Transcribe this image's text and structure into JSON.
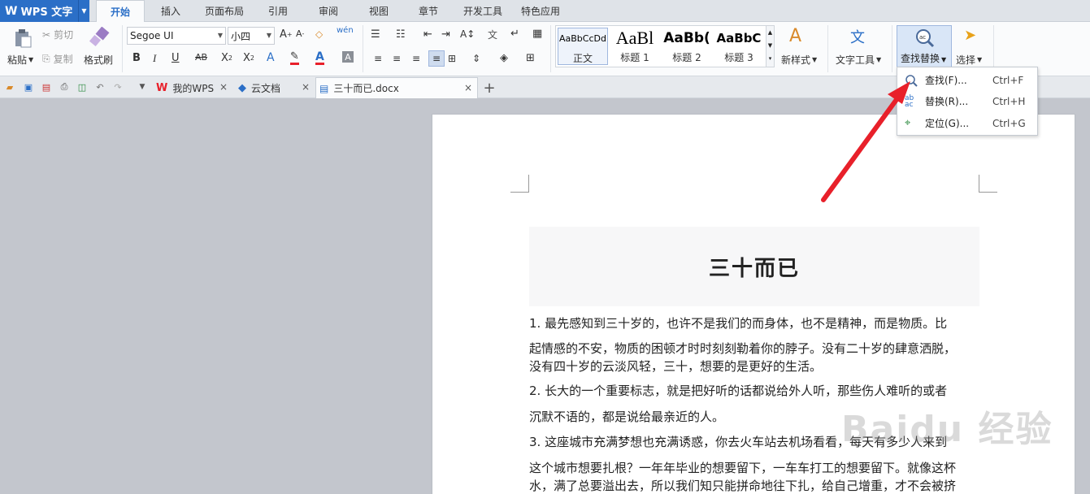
{
  "app": {
    "logo": "W",
    "name": "WPS 文字"
  },
  "menu_tabs": [
    "开始",
    "插入",
    "页面布局",
    "引用",
    "审阅",
    "视图",
    "章节",
    "开发工具",
    "特色应用"
  ],
  "ribbon": {
    "paste": "粘贴",
    "cut": "剪切",
    "copy": "复制",
    "format_painter": "格式刷",
    "font_name": "Segoe UI",
    "font_size": "小四",
    "styles": [
      {
        "sample": "AaBbCcDd",
        "label": "正文"
      },
      {
        "sample": "AaBl",
        "label": "标题 1"
      },
      {
        "sample": "AaBb(",
        "label": "标题 2"
      },
      {
        "sample": "AaBbC",
        "label": "标题 3"
      }
    ],
    "new_style": "新样式",
    "text_tools": "文字工具",
    "find_replace": "查找替换",
    "select": "选择"
  },
  "doc_tabs": [
    {
      "label": "我的WPS",
      "close": "×"
    },
    {
      "label": "云文档",
      "close": "×"
    },
    {
      "label": "三十而已.docx",
      "close": "×"
    }
  ],
  "new_tab": "+",
  "find_menu": [
    {
      "label": "查找(F)...",
      "shortcut": "Ctrl+F"
    },
    {
      "label": "替换(R)...",
      "shortcut": "Ctrl+H"
    },
    {
      "label": "定位(G)...",
      "shortcut": "Ctrl+G"
    }
  ],
  "document": {
    "title": "三十而已",
    "lines": [
      "1. 最先感知到三十岁的，也许不是我们的而身体，也不是精神，而是物质。比",
      "起情感的不安，物质的困顿才时时刻刻勒着你的脖子。没有二十岁的肆意洒脱，",
      "没有四十岁的云淡风轻，三十，想要的是更好的生活。",
      "2. 长大的一个重要标志，就是把好听的话都说给外人听，那些伤人难听的或者",
      "沉默不语的，都是说给最亲近的人。",
      "3. 这座城市充满梦想也充满诱惑，你去火车站去机场看看，每天有多少人来到",
      "这个城市想要扎根？一年年毕业的想要留下，一车车打工的想要留下。就像这杯",
      "水，满了总要溢出去，所以我们知只能拼命地往下扎，给自己增重，才不会被挤"
    ]
  },
  "watermark": "Baidu 经验",
  "colors": {
    "accent": "#2b6fc7",
    "arrow": "#e8202a"
  }
}
